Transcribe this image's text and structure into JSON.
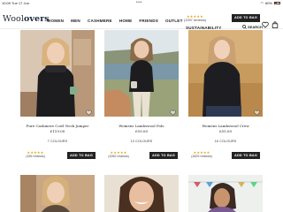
{
  "status": {
    "time": "10:09",
    "date": "Tue 17 Jun",
    "dots": "•••",
    "battery": "80%"
  },
  "header": {
    "logo_a": "Wool",
    "logo_b": "overs",
    "nav": [
      "WOMEN",
      "MEN",
      "CASHMERE",
      "HOME",
      "FRIENDS",
      "OUTLET"
    ],
    "nav_sub": "SUSTAINABILITY",
    "rating_stars": "★★★★★",
    "rating_count": "(1397 reviews)",
    "add_label": "ADD TO BAG",
    "search_label": "SEARCH"
  },
  "products": [
    {
      "name": "Pure Cashmere Cowl Neck Jumper",
      "price": "£119.00",
      "colours": "7 COLOURS",
      "stars": "★★★★★",
      "reviews": "(155 reviews)",
      "button": "ADD TO BAG"
    },
    {
      "name": "Womens Lambswool Polo",
      "price": "£59.00",
      "colours": "13 COLOURS",
      "stars": "★★★★★",
      "reviews": "(1052 reviews)",
      "button": "ADD TO BAG"
    },
    {
      "name": "Womens Lambswool Crew",
      "price": "£55.00",
      "colours": "16 COLOURS",
      "stars": "★★★★★",
      "reviews": "(1629 reviews)",
      "button": "ADD TO BAG"
    }
  ],
  "colors": {
    "accent": "#222222",
    "star": "#e8a317"
  },
  "icons": [
    "search-icon",
    "heart-icon",
    "bag-icon",
    "wishlist-heart-icon"
  ]
}
